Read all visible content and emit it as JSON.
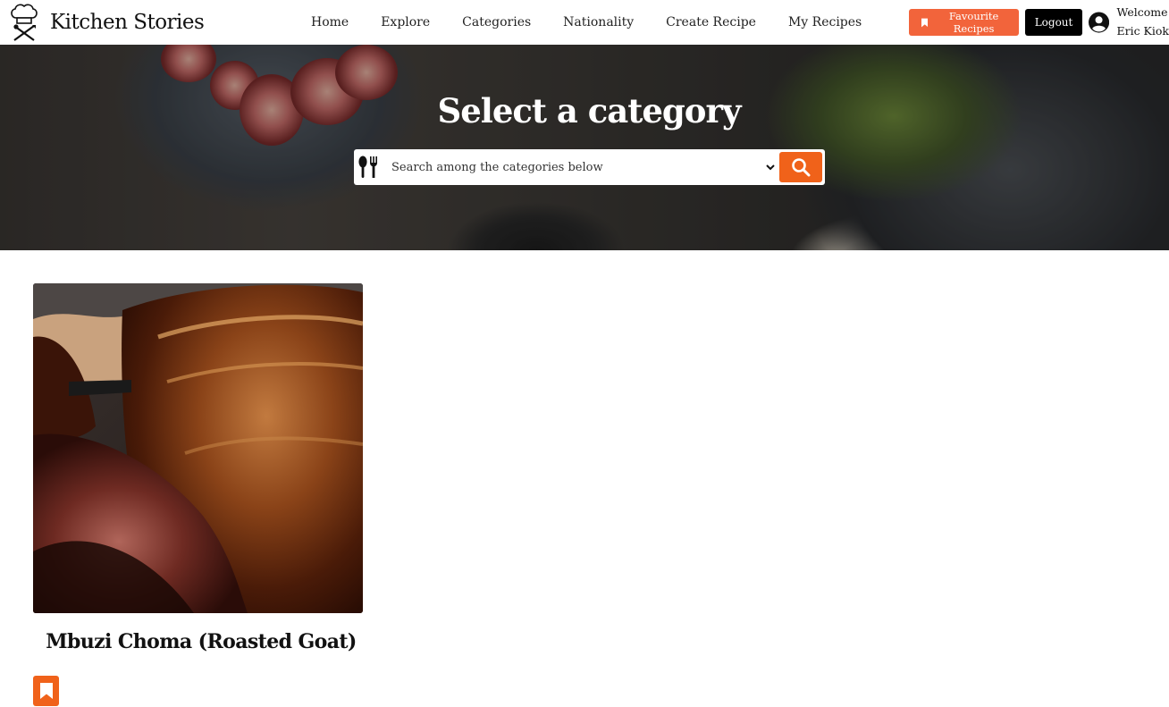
{
  "brand": {
    "name": "Kitchen Stories",
    "icon": "chef-hat-icon"
  },
  "nav": {
    "links": [
      "Home",
      "Explore",
      "Categories",
      "Nationality",
      "Create Recipe",
      "My Recipes"
    ]
  },
  "user": {
    "favourites_label": "Favourite Recipes",
    "logout_label": "Logout",
    "welcome_line1": "Welcome",
    "welcome_line2": "Eric Kiok"
  },
  "hero": {
    "title": "Select a category",
    "search_placeholder": "Search among the categories below"
  },
  "recipes": [
    {
      "title": "Mbuzi Choma (Roasted Goat)"
    }
  ],
  "colors": {
    "accent": "#f0621a",
    "favourites_button": "#f2643b",
    "logout_button": "#000000"
  }
}
